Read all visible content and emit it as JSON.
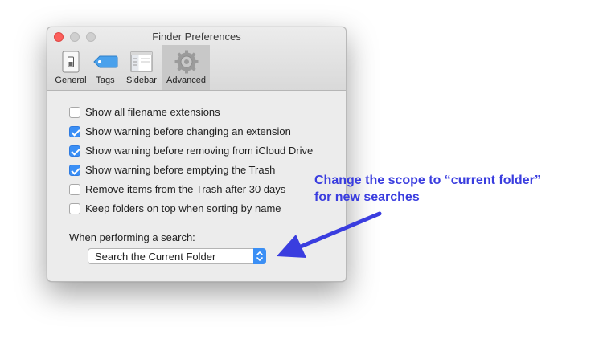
{
  "window": {
    "title": "Finder Preferences",
    "tabs": [
      {
        "label": "General",
        "icon": "switch-icon"
      },
      {
        "label": "Tags",
        "icon": "tag-icon"
      },
      {
        "label": "Sidebar",
        "icon": "sidebar-icon"
      },
      {
        "label": "Advanced",
        "icon": "gear-icon",
        "active": true
      }
    ]
  },
  "options": [
    {
      "label": "Show all filename extensions",
      "checked": false
    },
    {
      "label": "Show warning before changing an extension",
      "checked": true
    },
    {
      "label": "Show warning before removing from iCloud Drive",
      "checked": true
    },
    {
      "label": "Show warning before emptying the Trash",
      "checked": true
    },
    {
      "label": "Remove items from the Trash after 30 days",
      "checked": false
    },
    {
      "label": "Keep folders on top when sorting by name",
      "checked": false
    }
  ],
  "search": {
    "label": "When performing a search:",
    "selected": "Search the Current Folder"
  },
  "annotation": {
    "line1": "Change the scope to “current folder”",
    "line2": "for new searches",
    "color": "#3a3ddf"
  },
  "colors": {
    "accent": "#3b8ff5",
    "close": "#fc605c"
  }
}
